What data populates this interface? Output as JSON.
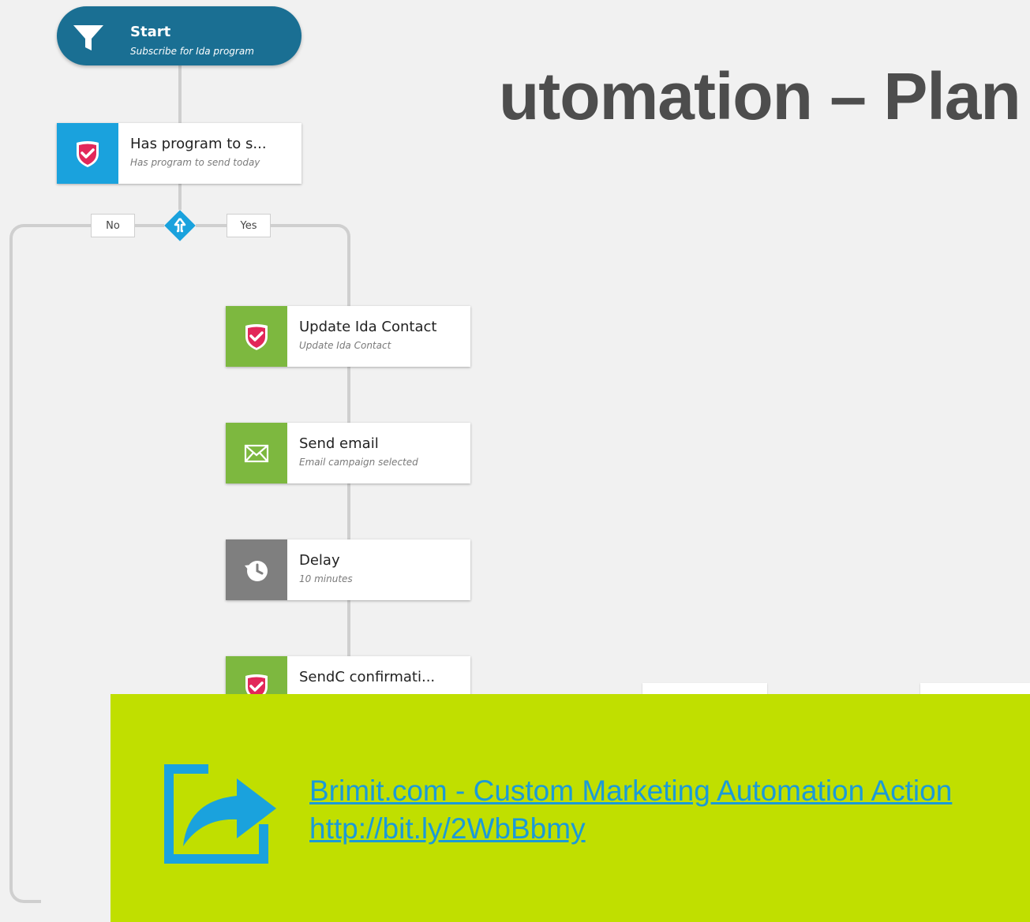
{
  "page": {
    "heading": "utomation – Plan"
  },
  "start": {
    "title": "Start",
    "subtitle": "Subscribe for Ida program",
    "icon": "funnel-icon"
  },
  "condition": {
    "title": "Has program to s...",
    "subtitle": "Has program to send today",
    "icon": "shield-check-icon"
  },
  "branches": {
    "no": "No",
    "yes": "Yes",
    "icon": "split-diamond-icon"
  },
  "steps": [
    {
      "title": "Update Ida Contact",
      "subtitle": "Update Ida Contact",
      "icon": "shield-check-icon"
    },
    {
      "title": "Send email",
      "subtitle": "Email campaign selected",
      "icon": "envelope-icon"
    },
    {
      "title": "Delay",
      "subtitle": "10 minutes",
      "icon": "clock-history-icon"
    },
    {
      "title": "SendC confirmati...",
      "subtitle": "",
      "icon": "shield-check-icon"
    }
  ],
  "banner": {
    "link_text": "Brimit.com - Custom Marketing Automation Action",
    "url_text": "http://bit.ly/2WbBbmy",
    "icon": "share-arrow-icon"
  },
  "colors": {
    "start_node": "#1a6f93",
    "condition_side": "#1aa2dd",
    "action_side": "#7db83f",
    "delay_side": "#7f7f7f",
    "shield": "#e2275a",
    "banner_bg": "#c0df00",
    "link": "#1b9ad8"
  }
}
